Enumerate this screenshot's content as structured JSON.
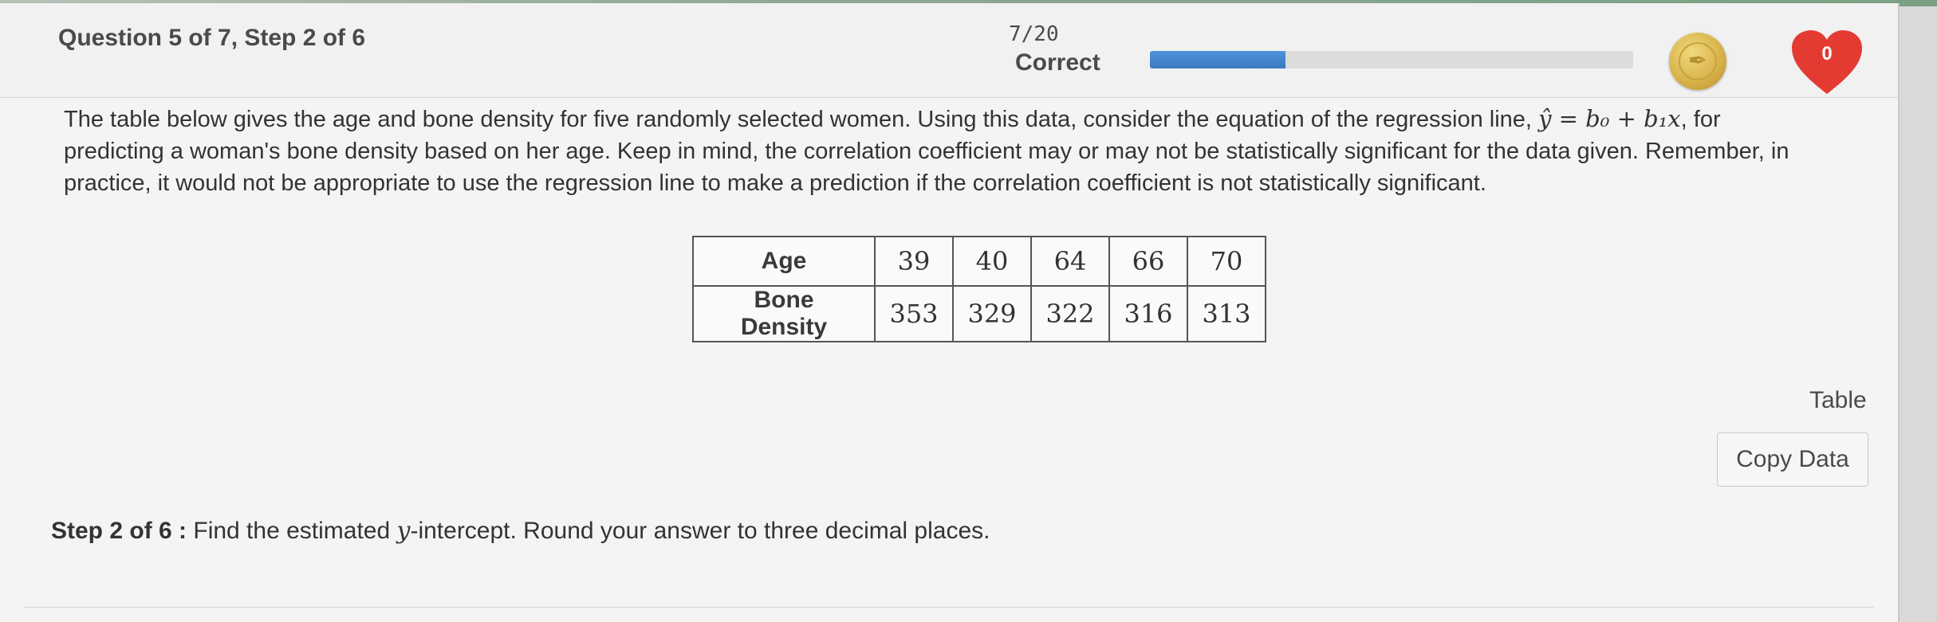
{
  "header": {
    "question_label": "Question 5 of 7, Step 2 of 6",
    "score": "7/20",
    "score_label": "Correct",
    "progress_fraction": 0.28,
    "hearts_count": "0",
    "colors": {
      "progress": "#3b79c2",
      "heart": "#e33b32",
      "coin": "#d9b44c"
    }
  },
  "problem": {
    "line1_before": "The table below gives the age and bone density for five randomly selected women. Using this data, consider the equation of the regression line, ",
    "equation": "ŷ = b₀ + b₁x",
    "line1_after": ", for",
    "line2": "predicting a woman's bone density based on her age. Keep in mind, the correlation coefficient may or may not be statistically significant for the data given. Remember, in",
    "line3": "practice, it would not be appropriate to use the regression line to make a prediction if the correlation coefficient is not statistically significant."
  },
  "table": {
    "rows": [
      {
        "label": "Age",
        "values": [
          "39",
          "40",
          "64",
          "66",
          "70"
        ]
      },
      {
        "label": "Bone Density",
        "values": [
          "353",
          "329",
          "322",
          "316",
          "313"
        ]
      }
    ]
  },
  "actions": {
    "table_link": "Table",
    "copy_button": "Copy Data"
  },
  "step": {
    "label": "Step 2 of 6 :",
    "text_before": " Find the estimated ",
    "variable": "y",
    "text_after": "-intercept. Round your answer to three decimal places."
  }
}
